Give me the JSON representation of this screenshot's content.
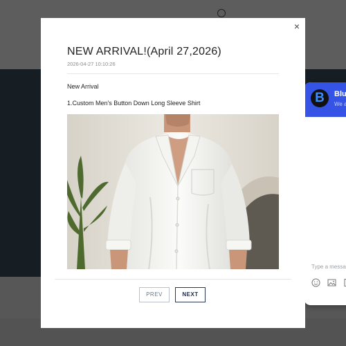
{
  "modal": {
    "close_symbol": "×",
    "title": "NEW ARRIVAL!(April 27,2026)",
    "date": "2026-04-27 10:10:26",
    "paragraph_1": "New Arrival",
    "paragraph_2": "1.Custom Men's Button Down Long Sleeve Shirt",
    "image_subject": "man in white long sleeve button-down shirt",
    "prev_label": "PREV",
    "next_label": "NEXT"
  },
  "chat": {
    "logo_letter": "B",
    "name": "Blue",
    "subtitle": "We a",
    "input_placeholder": "Type a messag",
    "icons": [
      "emoji-icon",
      "image-icon",
      "attachment-icon"
    ],
    "header_color": "#3554e5"
  }
}
